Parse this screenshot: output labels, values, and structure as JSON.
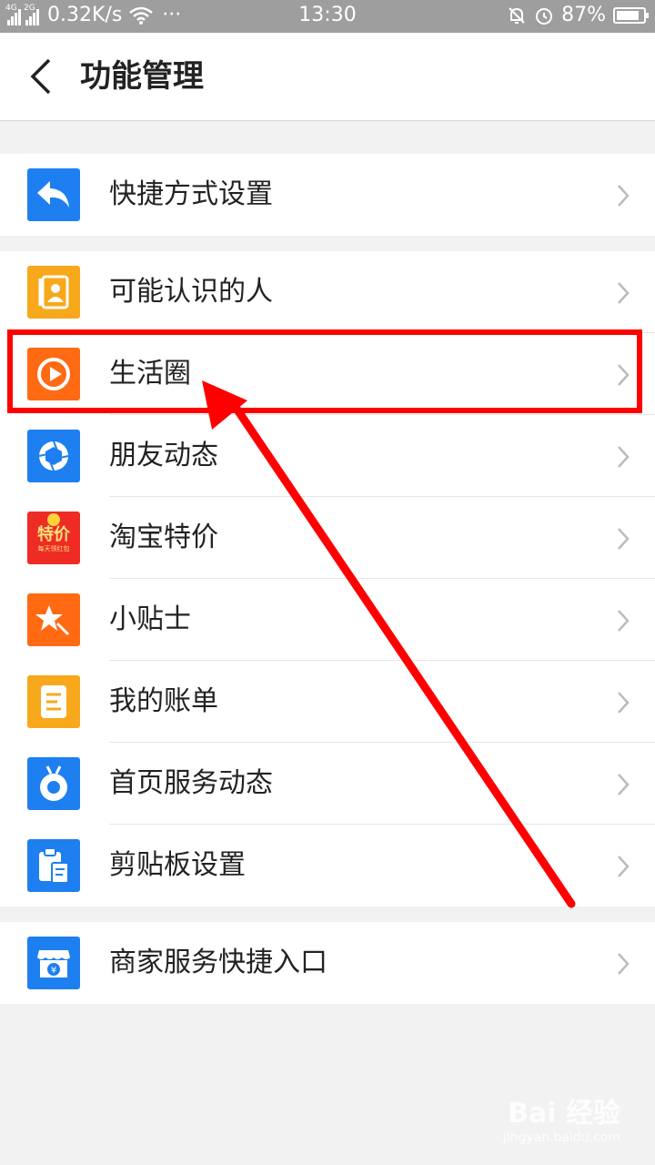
{
  "status_bar": {
    "net_4g": "4G",
    "net_2g": "2G",
    "speed": "0.32K/s",
    "dots": "···",
    "time": "13:30",
    "battery": "87%",
    "battery_level": 0.87
  },
  "header": {
    "title": "功能管理"
  },
  "groups": [
    {
      "items": [
        {
          "label": "快捷方式设置",
          "icon": "reply-arrow-icon",
          "color": "#1d7ff0"
        }
      ]
    },
    {
      "items": [
        {
          "label": "可能认识的人",
          "icon": "contact-book-icon",
          "color": "#f7a81b"
        },
        {
          "label": "生活圈",
          "icon": "play-circle-icon",
          "color": "#ff6a13"
        },
        {
          "label": "朋友动态",
          "icon": "aperture-icon",
          "color": "#1d7ff0"
        },
        {
          "label": "淘宝特价",
          "icon": "taobao-deal-icon",
          "color": "#ee2b25"
        },
        {
          "label": "小贴士",
          "icon": "magic-star-icon",
          "color": "#ff6a13"
        },
        {
          "label": "我的账单",
          "icon": "bill-document-icon",
          "color": "#f7a81b"
        },
        {
          "label": "首页服务动态",
          "icon": "bug-circle-icon",
          "color": "#1d7ff0"
        },
        {
          "label": "剪贴板设置",
          "icon": "clipboard-icon",
          "color": "#1d7ff0"
        }
      ]
    },
    {
      "items": [
        {
          "label": "商家服务快捷入口",
          "icon": "merchant-store-icon",
          "color": "#1d7ff0"
        }
      ]
    }
  ],
  "taobao_badge": {
    "line1": "特价",
    "line2": "每天领红包"
  },
  "annotation": {
    "color": "#ff0000"
  },
  "watermark": {
    "brand": "Bai  经验",
    "url": "jingyan.baidu.com"
  }
}
